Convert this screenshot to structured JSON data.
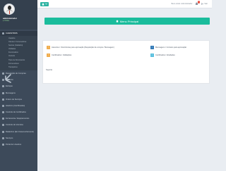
{
  "profile": {
    "name": "administrador",
    "status": "● Online"
  },
  "sidebar": {
    "groups": [
      {
        "label": "CADASTROS",
        "children": [
          "Usuários",
          "Clientes / Fornecedores",
          "Setores (Cadastro)",
          "Unidades",
          "Funcionários",
          "Veículos",
          "Tipos de Documentos",
          "Fornecedores",
          "Transportes"
        ]
      }
    ],
    "items": [
      "Requisição de Compras",
      "Produtos",
      "Estoque",
      "Mensagens",
      "Ordem de Serviços",
      "Histórico (Certificados)",
      "Controle de Certificados",
      "Ferramenta / Equipamentos",
      "Controle de Veículos",
      "Relatórios (Em Desenvolvimento)",
      "Serviços",
      "Portal de Usuários"
    ]
  },
  "topbar": {
    "user": "Bem-vindo: Administrador",
    "notifications": "1",
    "logout": "Sair"
  },
  "main": {
    "title": "Menu Principal",
    "links": [
      {
        "label": "Assuntos / Ocorrências para aprovação (Requisição de compra / Mensagem)",
        "color": "#f0ad4e"
      },
      {
        "label": "Mensagens / Correios para aprovação",
        "color": "#337ab7"
      },
      {
        "label": "Certificados / Validações",
        "color": "#f0ad4e"
      },
      {
        "label": "Certificados / Atividades",
        "color": "#5bc0de"
      }
    ],
    "support": "Suporte"
  }
}
